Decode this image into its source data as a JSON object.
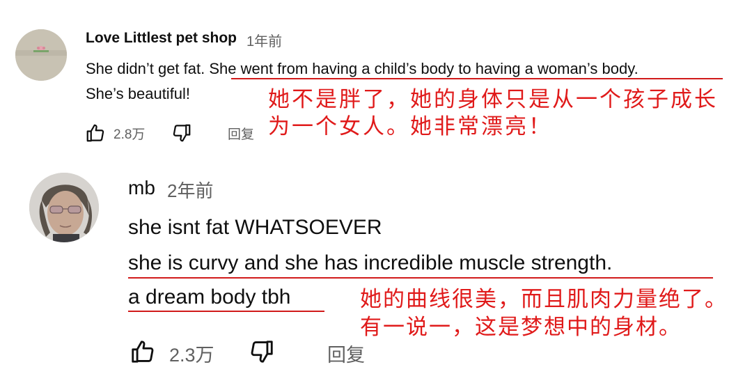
{
  "comments": [
    {
      "author": "Love Littlest pet shop",
      "time": "1年前",
      "text_line1_plain": "She didn’t get fat. ",
      "text_line1_underlined": "She went from having a child’s body to having a woman’s body",
      "text_line1_end": ".",
      "text_line2": "She’s beautiful!",
      "translation_line1": "她不是胖了，她的身体只是从一个孩子成长",
      "translation_line2": "为一个女人。她非常漂亮！",
      "likes": "2.8万",
      "reply_label": "回复"
    },
    {
      "author": "mb",
      "time": "2年前",
      "text_line1": "she isnt fat WHATSOEVER",
      "text_line2": "she is curvy and she has incredible muscle strength.",
      "text_line3": "a dream body tbh",
      "translation_line1": "她的曲线很美，而且肌肉力量绝了。",
      "translation_line2": "有一说一，这是梦想中的身材。",
      "likes": "2.3万",
      "reply_label": "回复"
    }
  ],
  "icons": {
    "like": "thumb-up-icon",
    "dislike": "thumb-down-icon"
  },
  "colors": {
    "annotation": "#e01a1a",
    "secondary_text": "#606060"
  }
}
